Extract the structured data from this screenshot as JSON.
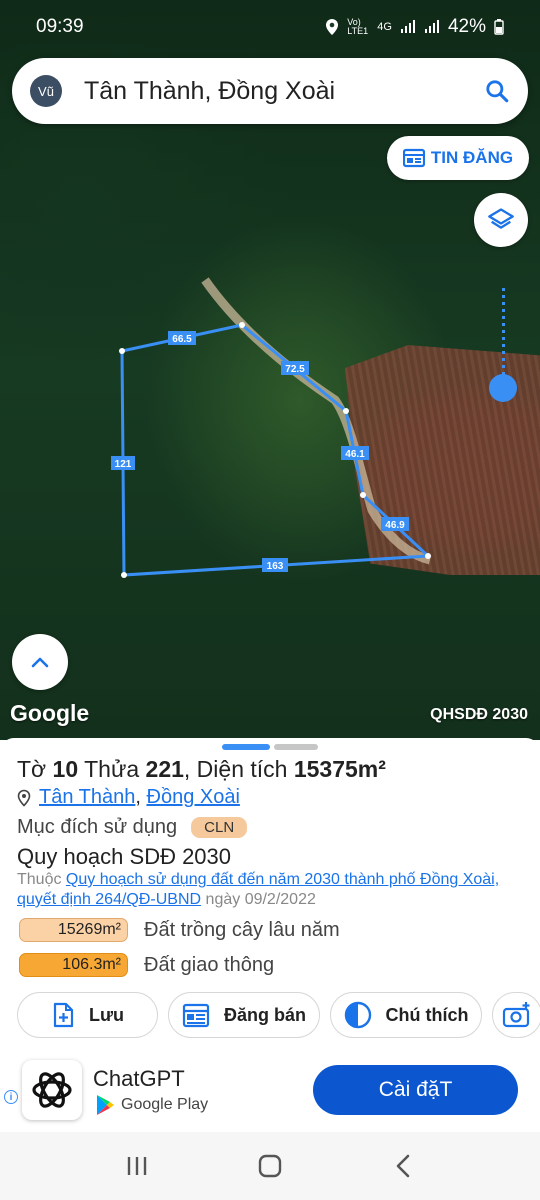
{
  "status_bar": {
    "time": "09:39",
    "network_label": "Vo) LTE1",
    "network_type": "4G",
    "battery": "42%"
  },
  "search": {
    "avatar_initials": "Vũ",
    "query": "Tân Thành, Đồng Xoài"
  },
  "map": {
    "tin_dang_label": "TIN ĐĂNG",
    "google_label": "Google",
    "layer_label": "QHSDĐ 2030",
    "zoom_level": 0.88,
    "plot_edges": [
      {
        "label": "66.5"
      },
      {
        "label": "72.5"
      },
      {
        "label": "46.1"
      },
      {
        "label": "46.9"
      },
      {
        "label": "163"
      },
      {
        "label": "121"
      }
    ]
  },
  "parcel": {
    "to_prefix": "Tờ",
    "to_number": "10",
    "thua_prefix": "Thửa",
    "thua_number": "221",
    "area_prefix": ", Diện tích",
    "area_value": "15375m²",
    "ward": "Tân Thành",
    "city": "Đồng Xoài",
    "purpose_label": "Mục đích sử dụng",
    "purpose_code": "CLN",
    "plan_title": "Quy hoạch SDĐ 2030",
    "plan_prefix": "Thuộc",
    "plan_link": "Quy hoạch sử dụng đất đến năm 2030 thành phố Đồng Xoài, quyết định 264/QĐ-UBND",
    "plan_date": "ngày 09/2/2022",
    "legend": [
      {
        "area": "15269m²",
        "label": "Đất trồng cây lâu năm",
        "color": "#fbd2a6"
      },
      {
        "area": "106.3m²",
        "label": "Đất giao thông",
        "color": "#f7a734"
      }
    ]
  },
  "actions": {
    "save_label": "Lưu",
    "sell_label": "Đăng bán",
    "note_label": "Chú thích"
  },
  "ad": {
    "app_name": "ChatGPT",
    "store_name": "Google Play",
    "install_label": "Cài đặT"
  },
  "colors": {
    "accent": "#1a73e8",
    "plot_outline": "#3a8ff5",
    "install_button": "#0c57d0"
  }
}
